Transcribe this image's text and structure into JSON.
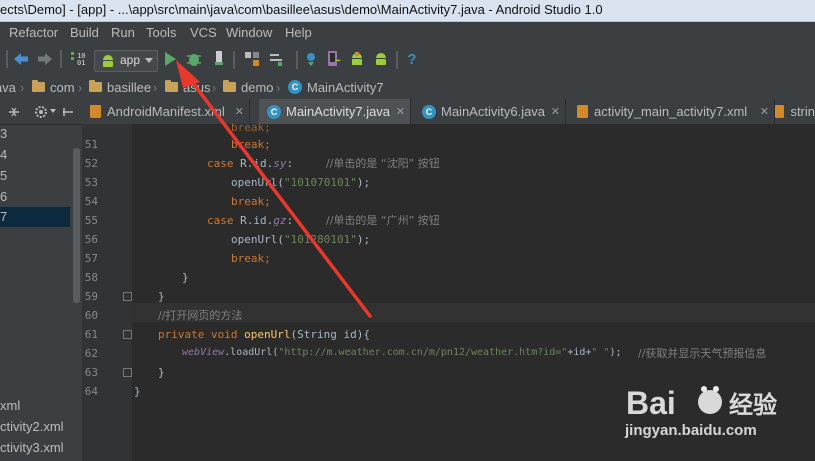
{
  "window": {
    "title": "ects\\Demo] - [app] - ...\\app\\src\\main\\java\\com\\basillee\\asus\\demo\\MainActivity7.java - Android Studio 1.0"
  },
  "menu": [
    "Refactor",
    "Build",
    "Run",
    "Tools",
    "VCS",
    "Window",
    "Help"
  ],
  "toolbar": {
    "run_config": "app",
    "help_label": "?"
  },
  "breadcrumb": [
    {
      "label": "java",
      "icon": "folder-icon"
    },
    {
      "label": "com",
      "icon": "folder-icon"
    },
    {
      "label": "basillee",
      "icon": "folder-icon"
    },
    {
      "label": "asus",
      "icon": "folder-icon"
    },
    {
      "label": "demo",
      "icon": "folder-icon"
    },
    {
      "label": "MainActivity7",
      "icon": "class-icon"
    }
  ],
  "tabs": [
    {
      "label": "AndroidManifest.xml",
      "icon": "xml-icon",
      "active": false
    },
    {
      "label": "MainActivity7.java",
      "icon": "class-icon",
      "active": true
    },
    {
      "label": "MainActivity6.java",
      "icon": "class-icon",
      "active": false
    },
    {
      "label": "activity_main_activity7.xml",
      "icon": "xml-icon",
      "active": false
    },
    {
      "label": "strin",
      "icon": "xml-icon",
      "active": false
    }
  ],
  "left_panel": {
    "rows": [
      "3",
      "4",
      "5",
      "6",
      "7"
    ],
    "selected": "7",
    "bottom_rows": [
      "xml",
      "ctivity2.xml",
      "ctivity3.xml"
    ]
  },
  "editor": {
    "line_numbers": [
      "51",
      "52",
      "53",
      "54",
      "55",
      "56",
      "57",
      "58",
      "59",
      "60",
      "61",
      "62",
      "63",
      "64"
    ],
    "partial_line_top": "break;",
    "lines": {
      "l51": {
        "kw": "break;"
      },
      "l52": {
        "kw_case": "case",
        "expr": "R.id.",
        "field": "sy",
        "colon": ":",
        "comment": "//单击的是 “沈阳” 按钮"
      },
      "l53": {
        "call": "openUrl(",
        "str": "\"101070101\"",
        "end": ");"
      },
      "l54": {
        "kw": "break;"
      },
      "l55": {
        "kw_case": "case",
        "expr": "R.id.",
        "field": "gz",
        "colon": ":",
        "comment": "//单击的是 “广州” 按钮"
      },
      "l56": {
        "call": "openUrl(",
        "str": "\"101280101\"",
        "end": ");"
      },
      "l57": {
        "kw": "break;"
      },
      "l58": {
        "text": "}"
      },
      "l59": {
        "text": "}"
      },
      "l60": {
        "comment": "//打开网页的方法"
      },
      "l61": {
        "kw1": "private",
        "kw2": "void",
        "fn": "openUrl",
        "params": "(String id){"
      },
      "l62": {
        "field": "webView",
        "call": ".loadUrl(",
        "str1": "\"http://m.weather.com.cn/m/pn12/weather.htm?id=\"",
        "plus": "+id+",
        "str2": "\" \"",
        "end": ");",
        "comment": "//获取并显示天气预报信息"
      },
      "l63": {
        "text": "}"
      },
      "l64": {
        "text": "}"
      }
    }
  },
  "watermark": {
    "brand": "Baiⓓ经验",
    "url": "jingyan.baidu.com"
  },
  "colors": {
    "keyword": "#cc7832",
    "string": "#6a8759",
    "comment": "#808080",
    "field": "#9876aa",
    "arrow": "#e8392c"
  }
}
